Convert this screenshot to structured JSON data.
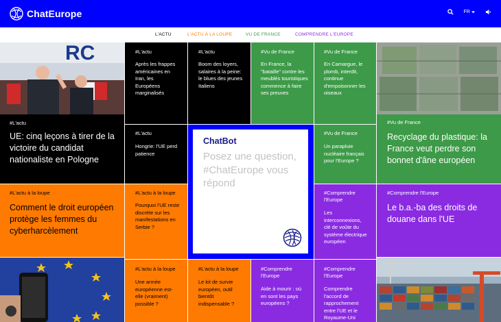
{
  "header": {
    "logo_text": "ChatEurope",
    "language": "FR",
    "icons": [
      "search-icon",
      "chevron-down-icon",
      "speaker-icon"
    ]
  },
  "nav": {
    "items": [
      {
        "label": "L'ACTU",
        "color": "#000000"
      },
      {
        "label": "L'ACTU À LA LOUPE",
        "color": "#ff7a00"
      },
      {
        "label": "VU DE FRANCE",
        "color": "#3d9a48"
      },
      {
        "label": "COMPRENDRE L'EUROPE",
        "color": "#8a2be2"
      }
    ]
  },
  "colors": {
    "header_blue": "#0000ff",
    "black": "#000000",
    "green": "#3d9a48",
    "orange": "#ff7a00",
    "purple": "#8a2be2"
  },
  "featured": {
    "poland": {
      "tag": "#L'actu",
      "title": "UE: cinq leçons à tirer de la victoire du candidat nationaliste en Pologne"
    },
    "plastic": {
      "tag": "#Vu de France",
      "title": "Recyclage du plastique: la France veut perdre son bonnet d'âne européen"
    },
    "harassment": {
      "tag": "#L'actu à la loupe",
      "title": "Comment le droit européen protège les femmes du cyberharcèlement"
    },
    "customs": {
      "tag": "#Comprendre l'Europe",
      "title": "Le b.a.-ba des droits de douane dans l'UE"
    }
  },
  "tiles": {
    "iran": {
      "tag": "#L'actu",
      "title": "Après les frappes américaines en Iran, les Européens marginalisés"
    },
    "rents": {
      "tag": "#L'actu",
      "title": "Boom des loyers, salaires à la peine: le blues des jeunes Italiens"
    },
    "furnished": {
      "tag": "#Vu de France",
      "title": "En France, la \"bataille\" contre les meublés touristiques commence à faire ses preuves"
    },
    "camargue": {
      "tag": "#Vu de France",
      "title": "En Camargue, le plomb, interdit, continue d'empoisonner les oiseaux"
    },
    "hungary": {
      "tag": "#L'actu",
      "title": "Hongrie: l'UE perd patience"
    },
    "nuclear": {
      "tag": "#Vu de France",
      "title": "Un parapluie nucléaire français pour l'Europe ?"
    },
    "serbia": {
      "tag": "#L'actu à la loupe",
      "title": "Pourquoi l'UE reste discrète sur les manifestations en Serbie ?"
    },
    "interconnections": {
      "tag": "#Comprendre l'Europe",
      "title": "Les interconnexions, clé de voûte du système électrique européen"
    },
    "army": {
      "tag": "#L'actu à la loupe",
      "title": "Une armée européenne est-elle (vraiment) possible ?"
    },
    "survival": {
      "tag": "#L'actu à la loupe",
      "title": "Le kit de survie européen, outil bientôt indispensable ?"
    },
    "dying": {
      "tag": "#Comprendre l'Europe",
      "title": "Aide à mourir : où en sont les pays européens ?"
    },
    "uk": {
      "tag": "#Comprendre l'Europe",
      "title": "Comprendre l'accord de rapprochement entre l'UE et le Royaume-Uni"
    }
  },
  "chatbot": {
    "title": "ChatBot",
    "prompt": "Posez une question, #ChatEurope vous répond"
  }
}
